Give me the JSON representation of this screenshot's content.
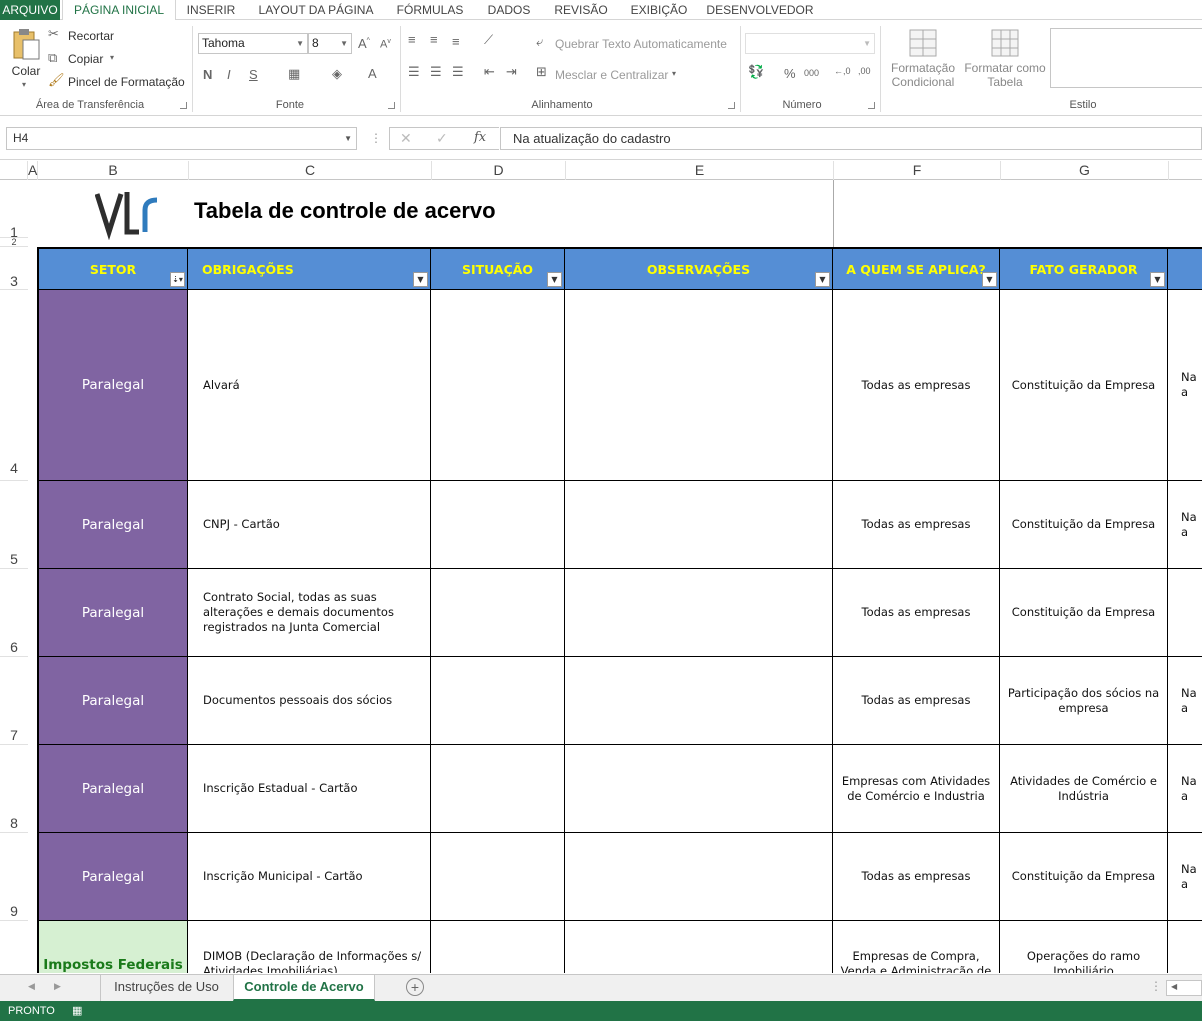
{
  "ribbon_tabs": [
    "ARQUIVO",
    "PÁGINA INICIAL",
    "INSERIR",
    "LAYOUT DA PÁGINA",
    "FÓRMULAS",
    "DADOS",
    "REVISÃO",
    "EXIBIÇÃO",
    "DESENVOLVEDOR"
  ],
  "clipboard": {
    "paste": "Colar",
    "cut": "Recortar",
    "copy": "Copiar",
    "format_painter": "Pincel de Formatação",
    "label": "Área de Transferência"
  },
  "font": {
    "name": "Tahoma",
    "size": "8",
    "bold": "N",
    "italic": "I",
    "underline": "S",
    "label": "Fonte"
  },
  "alignment": {
    "wrap": "Quebrar Texto Automaticamente",
    "merge": "Mesclar e Centralizar",
    "label": "Alinhamento"
  },
  "number": {
    "label": "Número",
    "percent": "%",
    "thousands": "000"
  },
  "styles": {
    "conditional_1": "Formatação",
    "conditional_2": "Condicional",
    "as_table_1": "Formatar como",
    "as_table_2": "Tabela",
    "label": "Estilo"
  },
  "formula_bar": {
    "name_box": "H4",
    "fx": "fx",
    "formula": "Na atualização do cadastro"
  },
  "columns": [
    "A",
    "B",
    "C",
    "D",
    "E",
    "F",
    "G"
  ],
  "rows": [
    "1",
    "2",
    "3",
    "4",
    "5",
    "6",
    "7",
    "8",
    "9"
  ],
  "sheet": {
    "title": "Tabela de controle de acervo",
    "logo_text": "VLR",
    "headers": [
      "SETOR",
      "OBRIGAÇÕES",
      "SITUAÇÃO",
      "OBSERVAÇÕES",
      "A QUEM SE APLICA?",
      "FATO GERADOR"
    ],
    "records": [
      {
        "setor": "Paralegal",
        "obrigacao": "Alvará",
        "aplica": "Todas as empresas",
        "fato": "Constituição da Empresa",
        "h": "Na a"
      },
      {
        "setor": "Paralegal",
        "obrigacao": "CNPJ - Cartão",
        "aplica": "Todas as empresas",
        "fato": "Constituição da Empresa",
        "h": "Na a"
      },
      {
        "setor": "Paralegal",
        "obrigacao": "Contrato Social, todas as suas alterações e demais documentos registrados na Junta Comercial",
        "aplica": "Todas as empresas",
        "fato": "Constituição da Empresa",
        "h": ""
      },
      {
        "setor": "Paralegal",
        "obrigacao": "Documentos pessoais dos sócios",
        "aplica": "Todas as empresas",
        "fato": "Participação dos sócios na empresa",
        "h": "Na a"
      },
      {
        "setor": "Paralegal",
        "obrigacao": "Inscrição Estadual - Cartão",
        "aplica": "Empresas com Atividades de Comércio e Industria",
        "fato": "Atividades de Comércio e Indústria",
        "h": "Na a"
      },
      {
        "setor": "Paralegal",
        "obrigacao": "Inscrição Municipal - Cartão",
        "aplica": "Todas as empresas",
        "fato": "Constituição da Empresa",
        "h": "Na a"
      },
      {
        "setor": "Impostos Federais",
        "obrigacao": "DIMOB (Declaração de Informações s/ Atividades Imobiliárias)",
        "aplica": "Empresas de Compra, Venda e Administração de Imóveis",
        "fato": "Operações do ramo Imobiliário",
        "h": ""
      }
    ]
  },
  "sheet_tabs": [
    "Instruções de Uso",
    "Controle de Acervo"
  ],
  "status": "PRONTO",
  "colors": {
    "excel_green": "#217346",
    "header_blue": "#558ed5",
    "header_text": "#ffff00",
    "setor_purple": "#8064a2",
    "setor_green": "#d6f0d2"
  }
}
